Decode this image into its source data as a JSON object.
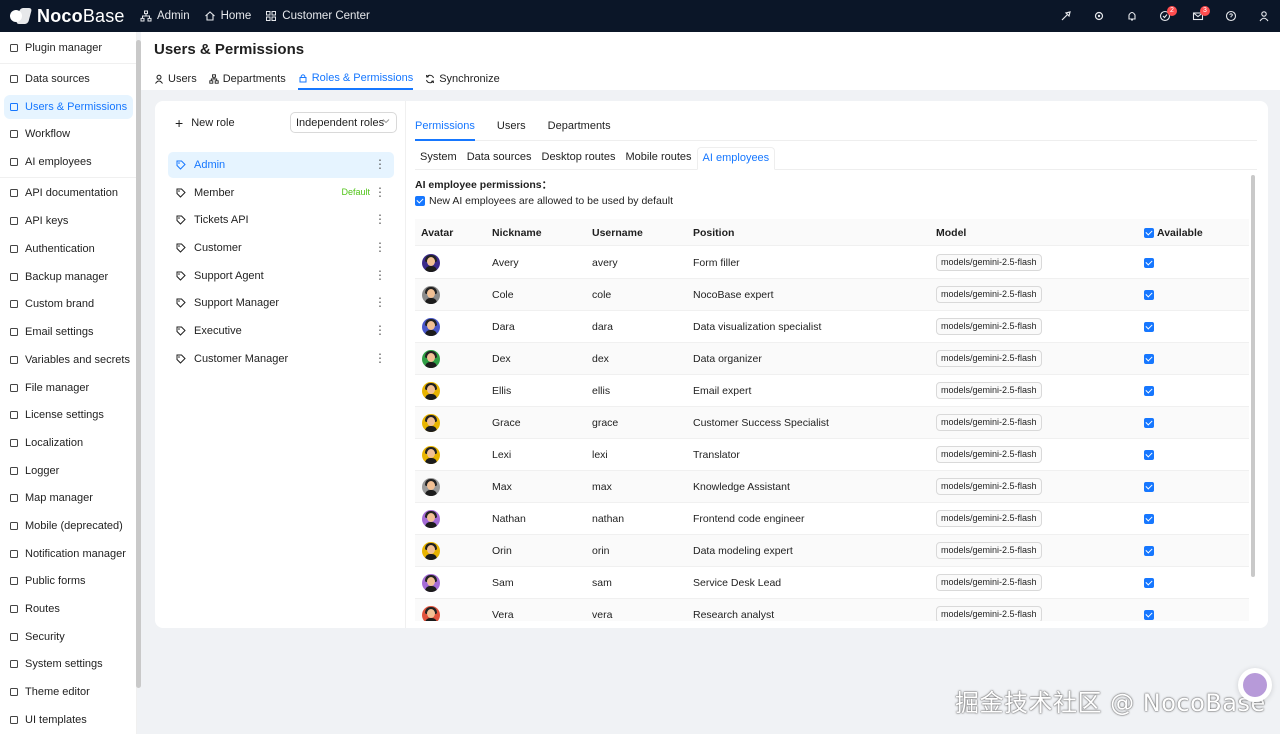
{
  "app": {
    "name_bold": "Noco",
    "name_light": "Base"
  },
  "topnav": [
    {
      "label": "Admin",
      "icon": "apartment-icon"
    },
    {
      "label": "Home",
      "icon": "home-icon"
    },
    {
      "label": "Customer Center",
      "icon": "app-grid-icon"
    }
  ],
  "topright": {
    "badge1": "2",
    "badge2": "3"
  },
  "sidebar": {
    "items": [
      {
        "label": "Plugin manager",
        "icon": "plugin-icon"
      },
      {
        "label": "Data sources",
        "icon": "database-icon"
      },
      {
        "label": "Users & Permissions",
        "icon": "users-icon",
        "active": true
      },
      {
        "label": "Workflow",
        "icon": "workflow-icon"
      },
      {
        "label": "AI employees",
        "icon": "ai-icon"
      },
      {
        "label": "API documentation",
        "icon": "doc-icon"
      },
      {
        "label": "API keys",
        "icon": "key-icon"
      },
      {
        "label": "Authentication",
        "icon": "login-icon"
      },
      {
        "label": "Backup manager",
        "icon": "backup-icon"
      },
      {
        "label": "Custom brand",
        "icon": "brand-icon"
      },
      {
        "label": "Email settings",
        "icon": "mail-icon"
      },
      {
        "label": "Variables and secrets",
        "icon": "table-icon"
      },
      {
        "label": "File manager",
        "icon": "file-icon"
      },
      {
        "label": "License settings",
        "icon": "license-icon"
      },
      {
        "label": "Localization",
        "icon": "globe-icon"
      },
      {
        "label": "Logger",
        "icon": "log-icon"
      },
      {
        "label": "Map manager",
        "icon": "map-pin-icon"
      },
      {
        "label": "Mobile (deprecated)",
        "icon": "mobile-icon"
      },
      {
        "label": "Notification manager",
        "icon": "notification-icon"
      },
      {
        "label": "Public forms",
        "icon": "form-icon"
      },
      {
        "label": "Routes",
        "icon": "routes-icon"
      },
      {
        "label": "Security",
        "icon": "shield-icon"
      },
      {
        "label": "System settings",
        "icon": "settings-icon"
      },
      {
        "label": "Theme editor",
        "icon": "theme-icon"
      },
      {
        "label": "UI templates",
        "icon": "template-icon"
      }
    ]
  },
  "page": {
    "title": "Users & Permissions",
    "tabs": [
      {
        "label": "Users",
        "icon": "user-icon"
      },
      {
        "label": "Departments",
        "icon": "apartment-icon"
      },
      {
        "label": "Roles & Permissions",
        "icon": "lock-icon",
        "active": true
      },
      {
        "label": "Synchronize",
        "icon": "sync-icon"
      }
    ]
  },
  "roles_panel": {
    "new_role_label": "New role",
    "role_mode": "Independent roles",
    "roles": [
      {
        "label": "Admin",
        "active": true
      },
      {
        "label": "Member",
        "badge": "Default"
      },
      {
        "label": "Tickets API"
      },
      {
        "label": "Customer"
      },
      {
        "label": "Support Agent"
      },
      {
        "label": "Support Manager"
      },
      {
        "label": "Executive"
      },
      {
        "label": "Customer Manager"
      }
    ]
  },
  "detail": {
    "tabs": [
      {
        "label": "Permissions",
        "active": true
      },
      {
        "label": "Users"
      },
      {
        "label": "Departments"
      }
    ],
    "subtabs": [
      {
        "label": "System"
      },
      {
        "label": "Data sources"
      },
      {
        "label": "Desktop routes"
      },
      {
        "label": "Mobile routes"
      },
      {
        "label": "AI employees",
        "active": true
      }
    ],
    "section_title": "AI employee permissions：",
    "default_checkbox_label": "New AI employees are allowed to be used by default",
    "columns": [
      "Avatar",
      "Nickname",
      "Username",
      "Position",
      "Model",
      "Available"
    ],
    "rows": [
      {
        "nickname": "Avery",
        "username": "avery",
        "position": "Form filler",
        "model": "models/gemini-2.5-flash",
        "color": "#3b2a8a"
      },
      {
        "nickname": "Cole",
        "username": "cole",
        "position": "NocoBase expert",
        "model": "models/gemini-2.5-flash",
        "color": "#8a8a8a"
      },
      {
        "nickname": "Dara",
        "username": "dara",
        "position": "Data visualization specialist",
        "model": "models/gemini-2.5-flash",
        "color": "#4a57c9"
      },
      {
        "nickname": "Dex",
        "username": "dex",
        "position": "Data organizer",
        "model": "models/gemini-2.5-flash",
        "color": "#2f9e44"
      },
      {
        "nickname": "Ellis",
        "username": "ellis",
        "position": "Email expert",
        "model": "models/gemini-2.5-flash",
        "color": "#e8b400"
      },
      {
        "nickname": "Grace",
        "username": "grace",
        "position": "Customer Success Specialist",
        "model": "models/gemini-2.5-flash",
        "color": "#e8b400"
      },
      {
        "nickname": "Lexi",
        "username": "lexi",
        "position": "Translator",
        "model": "models/gemini-2.5-flash",
        "color": "#e8b400"
      },
      {
        "nickname": "Max",
        "username": "max",
        "position": "Knowledge Assistant",
        "model": "models/gemini-2.5-flash",
        "color": "#9a9a9a"
      },
      {
        "nickname": "Nathan",
        "username": "nathan",
        "position": "Frontend code engineer",
        "model": "models/gemini-2.5-flash",
        "color": "#a46bd6"
      },
      {
        "nickname": "Orin",
        "username": "orin",
        "position": "Data modeling expert",
        "model": "models/gemini-2.5-flash",
        "color": "#e8b400"
      },
      {
        "nickname": "Sam",
        "username": "sam",
        "position": "Service Desk Lead",
        "model": "models/gemini-2.5-flash",
        "color": "#a46bd6"
      },
      {
        "nickname": "Vera",
        "username": "vera",
        "position": "Research analyst",
        "model": "models/gemini-2.5-flash",
        "color": "#e0533d"
      }
    ]
  },
  "watermark": "掘金技术社区 @ NocoBase"
}
